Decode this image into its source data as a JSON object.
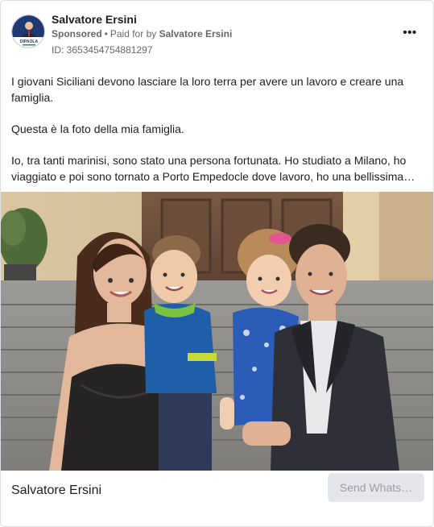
{
  "ad": {
    "page_name": "Salvatore Ersini",
    "sponsored_label": "Sponsored",
    "paid_for_prefix": "Paid for by",
    "paid_for_name": "Salvatore Ersini",
    "id_line": "ID: 3653454754881297",
    "more_icon": "more-dots-icon",
    "avatar_caption": "DIPAOLA",
    "body_paragraphs": [
      "I giovani Siciliani devono lasciare la loro terra per avere un lavoro e creare una famiglia.",
      "Questa è la foto della mia famiglia.",
      "Io, tra tanti marinisi, sono stato una persona fortunata. Ho studiato a Milano, ho viaggiato e poi sono tornato a Porto Empedocle dove lavoro, ho una bellissima…"
    ]
  },
  "footer": {
    "name": "Salvatore Ersini",
    "cta_label": "Send Whats…"
  },
  "colors": {
    "text_primary": "#1c1e21",
    "text_secondary": "#65676b",
    "button_bg": "#e4e6eb",
    "button_text": "#9a9da3"
  }
}
